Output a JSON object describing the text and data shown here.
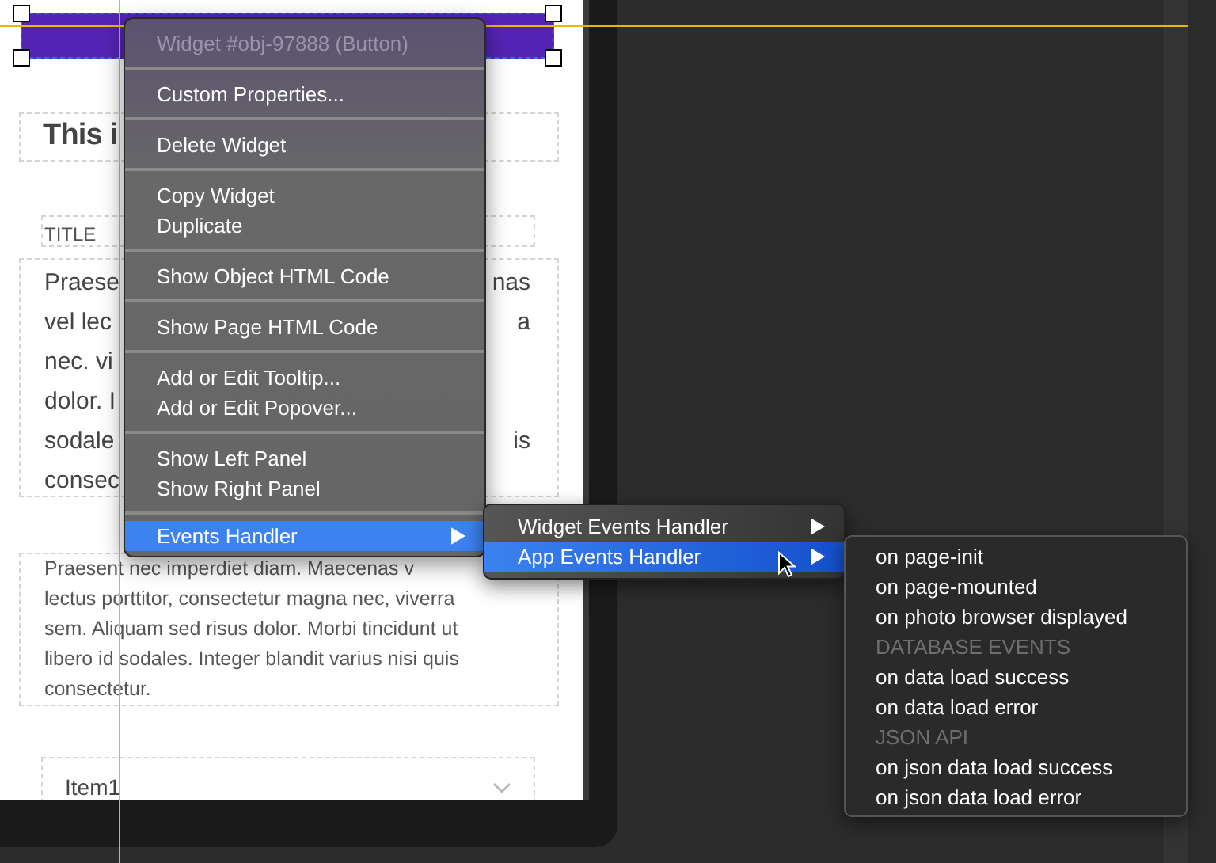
{
  "page": {
    "button_widget": {
      "selected": true
    },
    "heading": "This i",
    "title_label": "TITLE",
    "cursive_lines": [
      {
        "left": "Praese",
        "right": "nas"
      },
      {
        "left": "vel lec",
        "right": "a"
      },
      {
        "left": "nec. vi"
      },
      {
        "left": "dolor. I"
      },
      {
        "left": "sodale",
        "right": "is"
      },
      {
        "left": "consec"
      }
    ],
    "paragraph_lines": [
      "Praesent nec imperdiet diam. Maecenas v",
      "lectus porttitor, consectetur magna nec, viverra",
      "sem. Aliquam sed risus dolor. Morbi tincidunt ut",
      "libero id sodales. Integer blandit varius nisi quis",
      "consectetur."
    ],
    "accordion_item": "Item1"
  },
  "context_menu": {
    "header": {
      "label": "Widget #obj-97888 (Button)",
      "disabled": true
    },
    "groups": [
      [
        {
          "label": "Custom Properties...",
          "selected": false,
          "submenu": false
        }
      ],
      [
        {
          "label": "Delete Widget",
          "selected": false,
          "submenu": false
        }
      ],
      [
        {
          "label": "Copy Widget",
          "selected": false,
          "submenu": false
        },
        {
          "label": "Duplicate",
          "selected": false,
          "submenu": false
        }
      ],
      [
        {
          "label": "Show Object HTML Code",
          "selected": false,
          "submenu": false
        }
      ],
      [
        {
          "label": "Show Page HTML Code",
          "selected": false,
          "submenu": false
        }
      ],
      [
        {
          "label": "Add or Edit Tooltip...",
          "selected": false,
          "submenu": false
        },
        {
          "label": "Add or Edit Popover...",
          "selected": false,
          "submenu": false
        }
      ],
      [
        {
          "label": "Show Left Panel",
          "selected": false,
          "submenu": false
        },
        {
          "label": "Show Right Panel",
          "selected": false,
          "submenu": false
        }
      ],
      [
        {
          "label": "Events Handler",
          "selected": true,
          "submenu": true
        }
      ]
    ]
  },
  "events_submenu": [
    {
      "label": "Widget Events Handler",
      "selected": false,
      "submenu": true
    },
    {
      "label": "App Events Handler",
      "selected": true,
      "submenu": true
    }
  ],
  "app_events_submenu": [
    {
      "kind": "item",
      "label": "on page-init"
    },
    {
      "kind": "item",
      "label": "on page-mounted"
    },
    {
      "kind": "item",
      "label": "on photo browser displayed"
    },
    {
      "kind": "section",
      "label": "DATABASE EVENTS"
    },
    {
      "kind": "item",
      "label": "on data load success"
    },
    {
      "kind": "item",
      "label": "on data load error"
    },
    {
      "kind": "section",
      "label": "JSON API"
    },
    {
      "kind": "item",
      "label": "on json data load success"
    },
    {
      "kind": "item",
      "label": "on json data load error"
    }
  ]
}
